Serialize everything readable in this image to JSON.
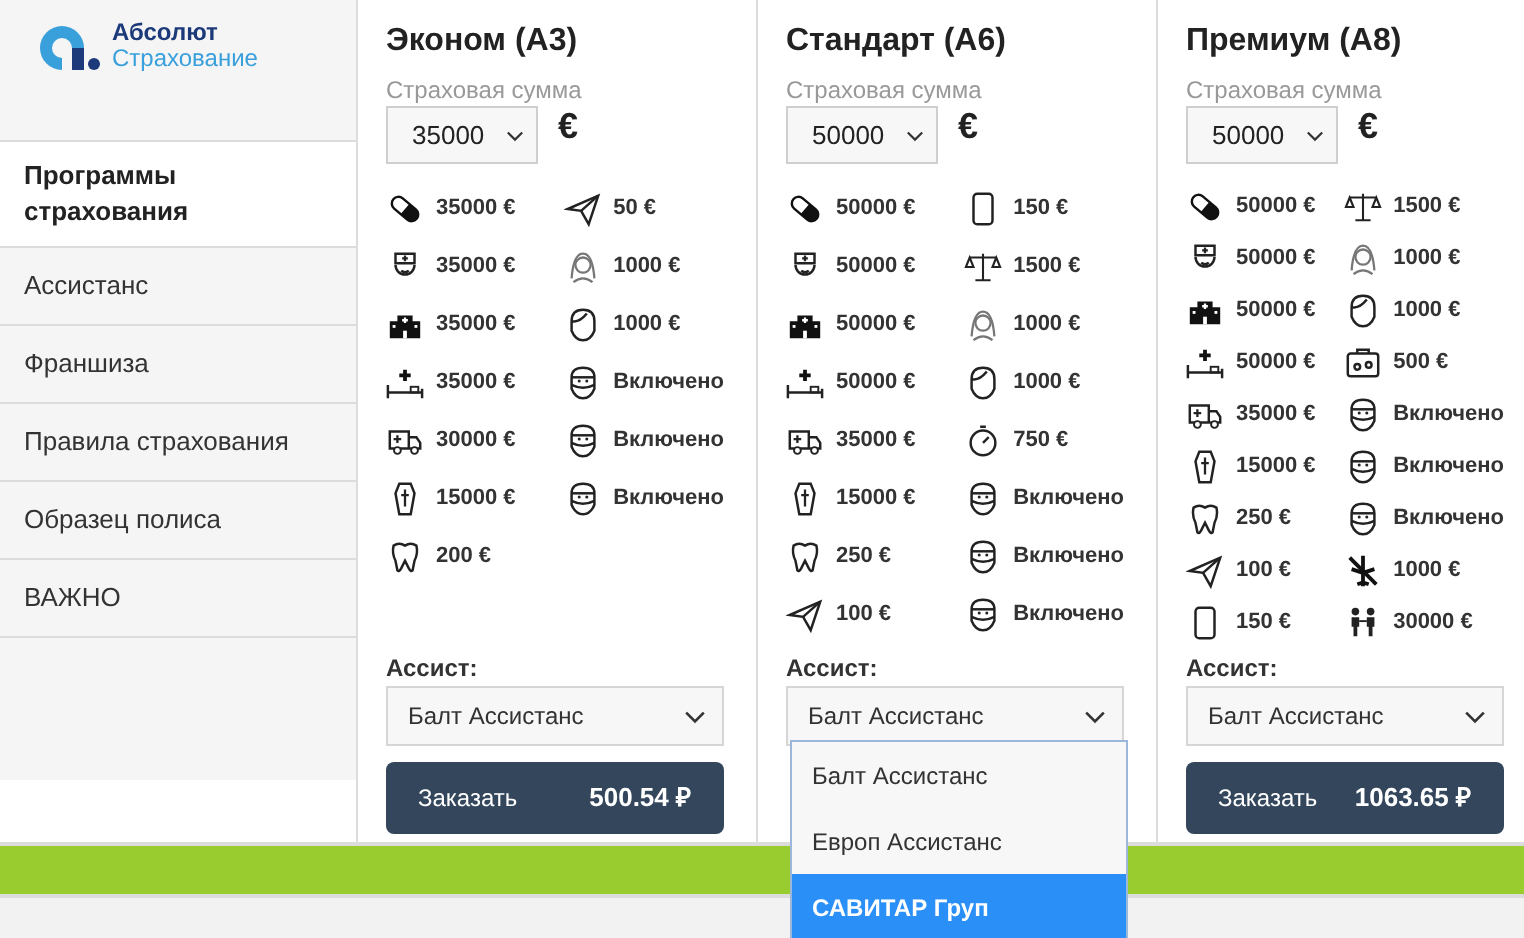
{
  "sidebar": {
    "logo": {
      "line_1": "Абсолют",
      "line_2": "Страхование"
    },
    "items": [
      {
        "label": "Программы страхования",
        "selected": true
      },
      {
        "label": "Ассистанс",
        "selected": false
      },
      {
        "label": "Франшиза",
        "selected": false
      },
      {
        "label": "Правила страхования",
        "selected": false
      },
      {
        "label": "Образец полиса",
        "selected": false
      },
      {
        "label": "ВАЖНО",
        "selected": false
      }
    ]
  },
  "plans": [
    {
      "title": "Эконом (A3)",
      "sum_label": "Страховая сумма",
      "sum_value": "35000",
      "currency": "€",
      "benefits_left": [
        {
          "kind": "pill",
          "value": "35000 €"
        },
        {
          "kind": "nurse",
          "value": "35000 €"
        },
        {
          "kind": "hospital",
          "value": "35000 €"
        },
        {
          "kind": "bed",
          "value": "35000 €"
        },
        {
          "kind": "ambulance",
          "value": "30000 €"
        },
        {
          "kind": "coffin",
          "value": "15000 €"
        },
        {
          "kind": "tooth",
          "value": "200 €"
        }
      ],
      "benefits_right": [
        {
          "kind": "plane",
          "value": "50 €"
        },
        {
          "kind": "woman",
          "value": "1000 €"
        },
        {
          "kind": "face",
          "value": "1000 €"
        },
        {
          "kind": "masked",
          "value": "Включено"
        },
        {
          "kind": "masked",
          "value": "Включено"
        },
        {
          "kind": "masked",
          "value": "Включено"
        }
      ],
      "assist_label": "Ассист:",
      "assist_value": "Балт Ассистанс",
      "order_label": "Заказать",
      "price": "500.54 ₽"
    },
    {
      "title": "Стандарт (A6)",
      "sum_label": "Страховая сумма",
      "sum_value": "50000",
      "currency": "€",
      "benefits_left": [
        {
          "kind": "pill",
          "value": "50000 €"
        },
        {
          "kind": "nurse",
          "value": "50000 €"
        },
        {
          "kind": "hospital",
          "value": "50000 €"
        },
        {
          "kind": "bed",
          "value": "50000 €"
        },
        {
          "kind": "ambulance",
          "value": "35000 €"
        },
        {
          "kind": "coffin",
          "value": "15000 €"
        },
        {
          "kind": "tooth",
          "value": "250 €"
        },
        {
          "kind": "plane",
          "value": "100 €"
        }
      ],
      "benefits_right": [
        {
          "kind": "phone",
          "value": "150 €"
        },
        {
          "kind": "scales",
          "value": "1500 €"
        },
        {
          "kind": "woman",
          "value": "1000 €"
        },
        {
          "kind": "face",
          "value": "1000 €"
        },
        {
          "kind": "stopwatch",
          "value": "750 €"
        },
        {
          "kind": "masked",
          "value": "Включено"
        },
        {
          "kind": "masked",
          "value": "Включено"
        },
        {
          "kind": "masked",
          "value": "Включено"
        }
      ],
      "assist_label": "Ассист:",
      "assist_value": "Балт Ассистанс",
      "assist_options": [
        {
          "label": "Балт Ассистанс",
          "selected": false
        },
        {
          "label": "Европ Ассистанс",
          "selected": false
        },
        {
          "label": "САВИТАР Груп",
          "selected": true
        }
      ]
    },
    {
      "title": "Премиум (A8)",
      "sum_label": "Страховая сумма",
      "sum_value": "50000",
      "currency": "€",
      "benefits_left": [
        {
          "kind": "pill",
          "value": "50000 €"
        },
        {
          "kind": "nurse",
          "value": "50000 €"
        },
        {
          "kind": "hospital",
          "value": "50000 €"
        },
        {
          "kind": "bed",
          "value": "50000 €"
        },
        {
          "kind": "ambulance",
          "value": "35000 €"
        },
        {
          "kind": "coffin",
          "value": "15000 €"
        },
        {
          "kind": "tooth",
          "value": "250 €"
        },
        {
          "kind": "plane",
          "value": "100 €"
        },
        {
          "kind": "phone",
          "value": "150 €"
        }
      ],
      "benefits_right": [
        {
          "kind": "scales",
          "value": "1500 €"
        },
        {
          "kind": "woman",
          "value": "1000 €"
        },
        {
          "kind": "face",
          "value": "1000 €"
        },
        {
          "kind": "suitcase",
          "value": "500 €"
        },
        {
          "kind": "masked",
          "value": "Включено"
        },
        {
          "kind": "masked",
          "value": "Включено"
        },
        {
          "kind": "masked",
          "value": "Включено"
        },
        {
          "kind": "no_flight",
          "value": "1000 €"
        },
        {
          "kind": "children",
          "value": "30000 €"
        }
      ],
      "assist_label": "Ассист:",
      "assist_value": "Балт Ассистанс",
      "order_label": "Заказать",
      "price": "1063.65 ₽"
    }
  ]
}
